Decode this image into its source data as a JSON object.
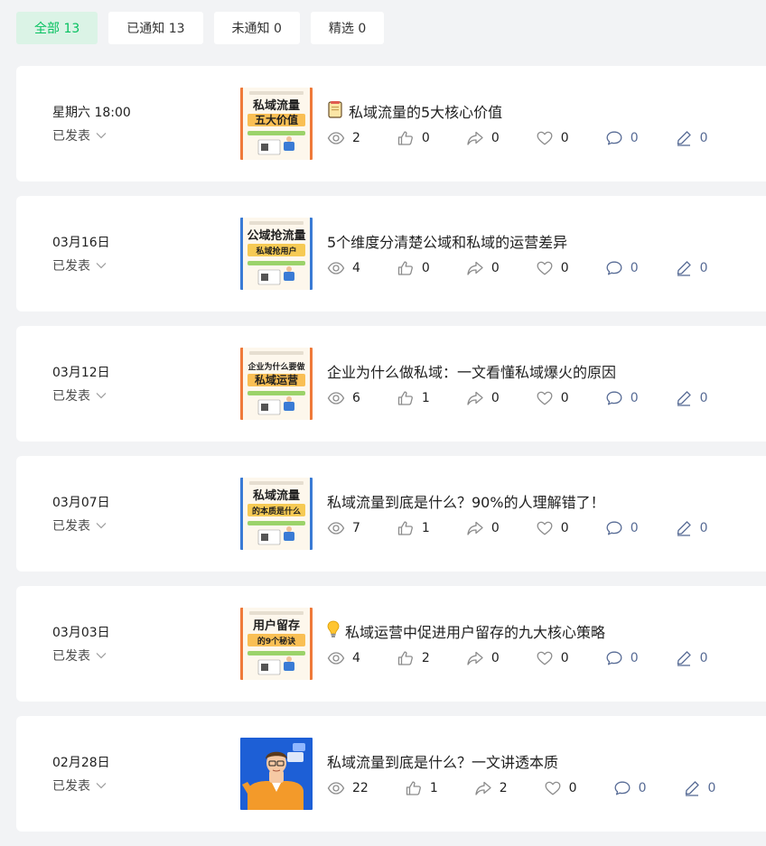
{
  "filters": [
    {
      "label": "全部 13",
      "active": true
    },
    {
      "label": "已通知 13",
      "active": false
    },
    {
      "label": "未通知 0",
      "active": false
    },
    {
      "label": "精选 0",
      "active": false
    }
  ],
  "colors": {
    "accent": "#07c160",
    "accent_bg": "#dbf3e6",
    "link_blue": "#576b95",
    "gray_icon": "#8c8c8c"
  },
  "articles": [
    {
      "date": "星期六 18:00",
      "status": "已发表",
      "title": "私域流量的5大核心价值",
      "title_icon": "notepad-icon",
      "thumb_text": [
        "私域流量",
        "五大价值"
      ],
      "thumb_style": "orange",
      "stats": {
        "views": "2",
        "likes": "0",
        "shares": "0",
        "favorites": "0",
        "comments": "0",
        "notes": "0"
      }
    },
    {
      "date": "03月16日",
      "status": "已发表",
      "title": "5个维度分清楚公域和私域的运营差异",
      "title_icon": "",
      "thumb_text": [
        "公域抢流量",
        "私域抢用户"
      ],
      "thumb_style": "blue",
      "stats": {
        "views": "4",
        "likes": "0",
        "shares": "0",
        "favorites": "0",
        "comments": "0",
        "notes": "0"
      }
    },
    {
      "date": "03月12日",
      "status": "已发表",
      "title": "企业为什么做私域：一文看懂私域爆火的原因",
      "title_icon": "",
      "thumb_text": [
        "企业为什么要做",
        "私域运营"
      ],
      "thumb_style": "orange",
      "stats": {
        "views": "6",
        "likes": "1",
        "shares": "0",
        "favorites": "0",
        "comments": "0",
        "notes": "0"
      }
    },
    {
      "date": "03月07日",
      "status": "已发表",
      "title": "私域流量到底是什么？90%的人理解错了！",
      "title_icon": "",
      "thumb_text": [
        "私域流量",
        "的本质是什么"
      ],
      "thumb_style": "blue",
      "stats": {
        "views": "7",
        "likes": "1",
        "shares": "0",
        "favorites": "0",
        "comments": "0",
        "notes": "0"
      }
    },
    {
      "date": "03月03日",
      "status": "已发表",
      "title": "私域运营中促进用户留存的九大核心策略",
      "title_icon": "lightbulb-icon",
      "thumb_text": [
        "用户留存",
        "的9个秘诀"
      ],
      "thumb_style": "orange",
      "stats": {
        "views": "4",
        "likes": "2",
        "shares": "0",
        "favorites": "0",
        "comments": "0",
        "notes": "0"
      }
    },
    {
      "date": "02月28日",
      "status": "已发表",
      "title": "私域流量到底是什么？一文讲透本质",
      "title_icon": "",
      "thumb_text": [],
      "thumb_style": "illustration",
      "stats": {
        "views": "22",
        "likes": "1",
        "shares": "2",
        "favorites": "0",
        "comments": "0",
        "notes": "0"
      }
    }
  ]
}
